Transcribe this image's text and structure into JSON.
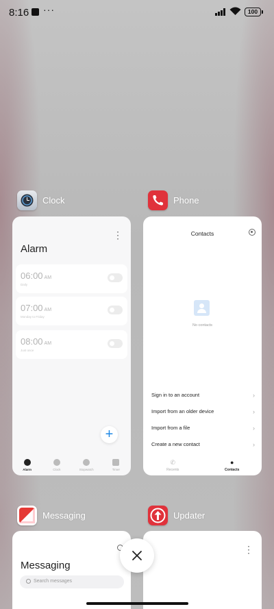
{
  "status_bar": {
    "time": "8:16",
    "more": "···",
    "battery": "100"
  },
  "apps": {
    "clock": {
      "name": "Clock",
      "title": "Alarm",
      "alarms": [
        {
          "time": "06:00",
          "ampm": "AM",
          "sub": "Daily",
          "enabled": false
        },
        {
          "time": "07:00",
          "ampm": "AM",
          "sub": "Monday to Friday",
          "enabled": false
        },
        {
          "time": "08:00",
          "ampm": "AM",
          "sub": "Just once",
          "enabled": false
        }
      ],
      "tabs": [
        {
          "label": "Alarm",
          "active": true
        },
        {
          "label": "Clock",
          "active": false
        },
        {
          "label": "Stopwatch",
          "active": false
        },
        {
          "label": "Timer",
          "active": false
        }
      ],
      "fab": "+"
    },
    "phone": {
      "name": "Phone",
      "title": "Contacts",
      "empty_text": "No contacts",
      "menu": [
        "Sign in to an account",
        "Import from an older device",
        "Import from a file",
        "Create a new contact"
      ],
      "tabs": [
        {
          "label": "Recents",
          "active": false
        },
        {
          "label": "Contacts",
          "active": true
        }
      ]
    },
    "messaging": {
      "name": "Messaging",
      "title": "Messaging",
      "search_placeholder": "Search messages"
    },
    "updater": {
      "name": "Updater"
    }
  },
  "colors": {
    "accent_blue": "#1e88e5",
    "app_red": "#e0323b"
  }
}
